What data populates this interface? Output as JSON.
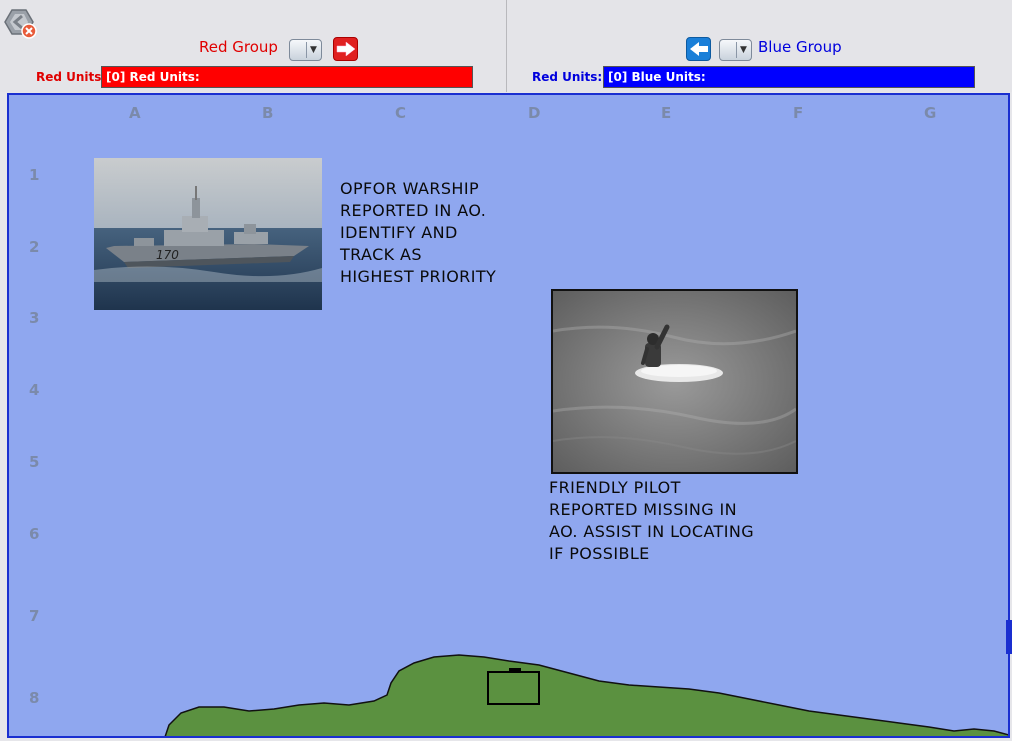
{
  "red_group": {
    "title": "Red Group",
    "units_label": "Red Units:",
    "units_value": "[0] Red Units:",
    "color": "#ff0000"
  },
  "blue_group": {
    "title": "Blue Group",
    "units_label": "Red Units:",
    "units_value": "[0] Blue Units:",
    "color": "#0000ff"
  },
  "map": {
    "columns": [
      "A",
      "B",
      "C",
      "D",
      "E",
      "F",
      "G"
    ],
    "rows": [
      "1",
      "2",
      "3",
      "4",
      "5",
      "6",
      "7",
      "8"
    ],
    "water_color": "#8fa7ef",
    "land_color": "#5b9140",
    "messages": {
      "warship": "OPFOR WARSHIP\nREPORTED IN AO.\nIDENTIFY AND\nTRACK AS\nHIGHEST PRIORITY",
      "pilot": "FRIENDLY PILOT\nREPORTED MISSING IN\nAO. ASSIST IN LOCATING\nIF POSSIBLE"
    },
    "hull_number": "170"
  },
  "icons": {
    "logo": "exit-app-icon",
    "red_send": "arrow-right-icon",
    "blue_send": "arrow-left-icon",
    "dropdown": "chevron-down-icon"
  }
}
